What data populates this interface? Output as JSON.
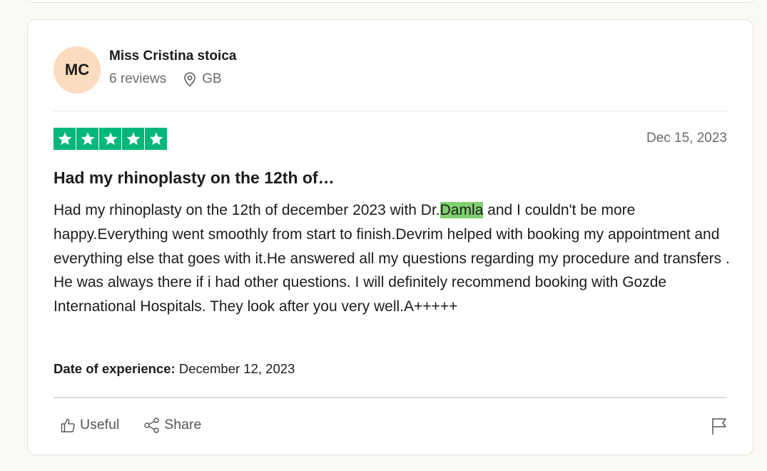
{
  "review": {
    "reviewer": {
      "initials": "MC",
      "name": "Miss Cristina stoica",
      "reviews_count": "6 reviews",
      "country": "GB",
      "avatar_color": "#fcdcbf"
    },
    "rating": 5,
    "star_color": "#00b67a",
    "date": "Dec 15, 2023",
    "title": "Had my rhinoplasty on the 12th of…",
    "body_before": "Had my rhinoplasty on the 12th of december 2023 with Dr.",
    "body_highlight": "Damla",
    "body_after": " and I couldn't be more happy.Everything went smoothly from start to finish.Devrim helped with booking my appointment and everything else that goes with it.He answered all my questions regarding my procedure and transfers . He was always there if i had other questions. I will definitely recommend booking with Gozde International Hospitals. They look after you very well.A+++++",
    "experience_label": "Date of experience:",
    "experience_date": " December 12, 2023",
    "actions": {
      "useful": "Useful",
      "share": "Share"
    },
    "icons": [
      "location-icon",
      "star-icon",
      "thumbs-up-icon",
      "share-icon",
      "flag-icon"
    ]
  }
}
